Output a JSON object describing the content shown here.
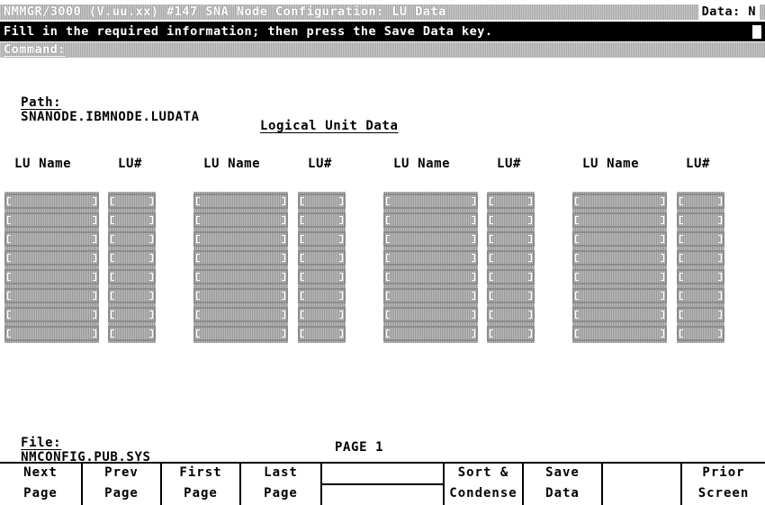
{
  "title_bar": {
    "title": "NMMGR/3000 (V.uu.xx) #147 SNA Node Configuration: LU Data",
    "data_flag": "Data: N"
  },
  "message_bar": {
    "message": "Fill in the required information; then press the Save Data key."
  },
  "command_bar": {
    "label": "Command:"
  },
  "path": {
    "label": "Path:",
    "value": "SNANODE.IBMNODE.LUDATA"
  },
  "section": {
    "heading": "Logical Unit Data"
  },
  "columns": [
    {
      "lu_name_header": "LU Name",
      "lu_num_header": "LU#"
    },
    {
      "lu_name_header": "LU Name",
      "lu_num_header": "LU#"
    },
    {
      "lu_name_header": "LU Name",
      "lu_num_header": "LU#"
    },
    {
      "lu_name_header": "LU Name",
      "lu_num_header": "LU#"
    }
  ],
  "rows_per_column": 8,
  "file": {
    "label": "File:",
    "value": "NMCONFIG.PUB.SYS"
  },
  "page_indicator": "PAGE 1",
  "function_keys": [
    {
      "line1": "Next",
      "line2": "Page"
    },
    {
      "line1": "Prev",
      "line2": "Page"
    },
    {
      "line1": "First",
      "line2": "Page"
    },
    {
      "line1": "Last",
      "line2": "Page"
    },
    {
      "line1": "",
      "line2": ""
    },
    {
      "line1": "Sort &",
      "line2": "Condense"
    },
    {
      "line1": "Save",
      "line2": "Data"
    },
    {
      "line1": "",
      "line2": ""
    },
    {
      "line1": "Prior",
      "line2": "Screen"
    }
  ],
  "colors": {
    "background": "#ffffff",
    "text": "#000000",
    "message_bar_bg": "#000000",
    "field_fill": "#a9a9a9"
  }
}
